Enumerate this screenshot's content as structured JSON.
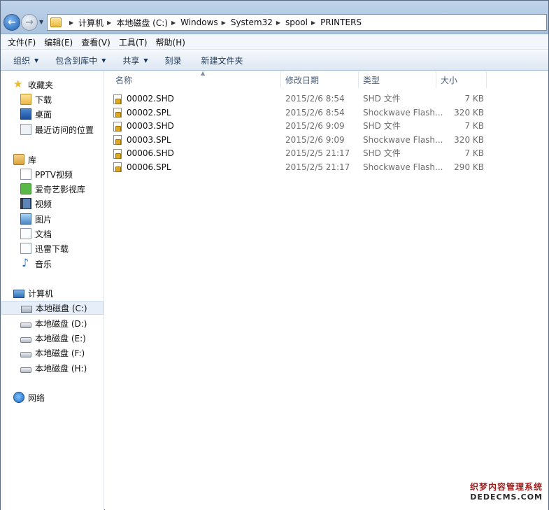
{
  "address": {
    "crumbs": [
      "计算机",
      "本地磁盘 (C:)",
      "Windows",
      "System32",
      "spool",
      "PRINTERS"
    ]
  },
  "menu": [
    "文件(F)",
    "编辑(E)",
    "查看(V)",
    "工具(T)",
    "帮助(H)"
  ],
  "commands": {
    "organize": "组织",
    "include_library": "包含到库中",
    "share": "共享",
    "burn": "刻录",
    "new_folder": "新建文件夹"
  },
  "nav": {
    "favorites": "收藏夹",
    "downloads": "下载",
    "desktop": "桌面",
    "recent": "最近访问的位置",
    "libraries": "库",
    "pptv": "PPTV视频",
    "iqiyi": "爱奇艺影视库",
    "videos": "视频",
    "pictures": "图片",
    "documents": "文档",
    "xunlei": "迅雷下载",
    "music": "音乐",
    "computer": "计算机",
    "drive_c": "本地磁盘 (C:)",
    "drive_d": "本地磁盘 (D:)",
    "drive_e": "本地磁盘 (E:)",
    "drive_f": "本地磁盘 (F:)",
    "drive_h": "本地磁盘 (H:)",
    "network": "网络"
  },
  "columns": {
    "name": "名称",
    "date": "修改日期",
    "type": "类型",
    "size": "大小"
  },
  "files": [
    {
      "name": "00002.SHD",
      "date": "2015/2/6 8:54",
      "type": "SHD 文件",
      "size": "7 KB"
    },
    {
      "name": "00002.SPL",
      "date": "2015/2/6 8:54",
      "type": "Shockwave Flash...",
      "size": "320 KB"
    },
    {
      "name": "00003.SHD",
      "date": "2015/2/6 9:09",
      "type": "SHD 文件",
      "size": "7 KB"
    },
    {
      "name": "00003.SPL",
      "date": "2015/2/6 9:09",
      "type": "Shockwave Flash...",
      "size": "320 KB"
    },
    {
      "name": "00006.SHD",
      "date": "2015/2/5 21:17",
      "type": "SHD 文件",
      "size": "7 KB"
    },
    {
      "name": "00006.SPL",
      "date": "2015/2/5 21:17",
      "type": "Shockwave Flash...",
      "size": "290 KB"
    }
  ],
  "watermark": {
    "cn": "织梦内容管理系统",
    "en": "DEDECMS.COM"
  }
}
